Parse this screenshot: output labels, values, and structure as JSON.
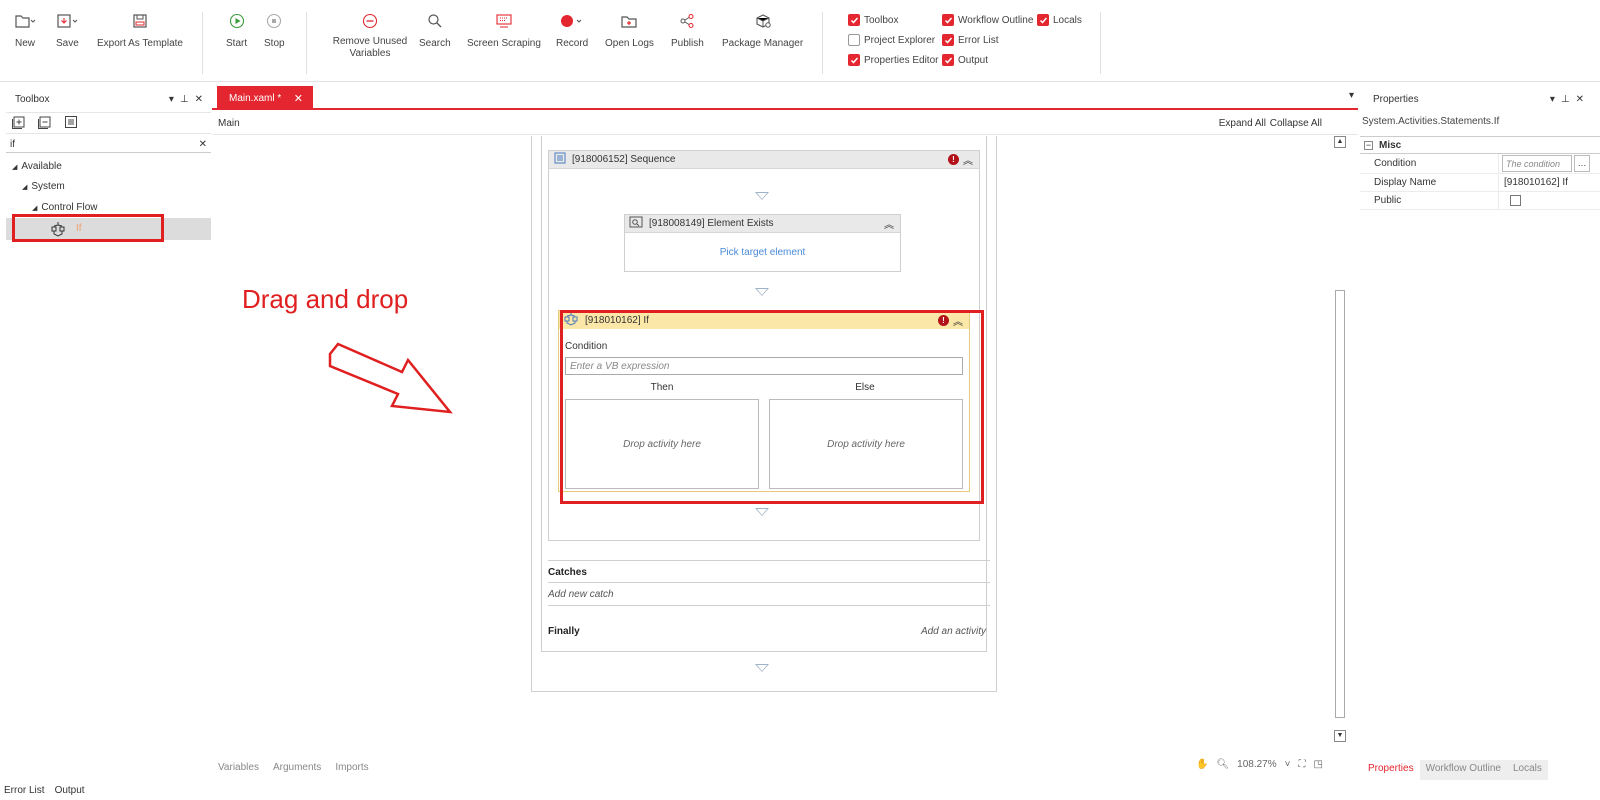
{
  "ribbon": {
    "buttons": [
      {
        "label": "New",
        "icon": "new-file-icon"
      },
      {
        "label": "Save",
        "icon": "save-icon"
      },
      {
        "label": "Export As Template",
        "icon": "export-template-icon"
      },
      {
        "label": "Start",
        "icon": "play-icon"
      },
      {
        "label": "Stop",
        "icon": "stop-icon"
      },
      {
        "label": "Remove Unused\nVariables",
        "icon": "remove-icon"
      },
      {
        "label": "Search",
        "icon": "search-icon"
      },
      {
        "label": "Screen Scraping",
        "icon": "screen-scraping-icon"
      },
      {
        "label": "Record",
        "icon": "record-icon"
      },
      {
        "label": "Open Logs",
        "icon": "folder-icon"
      },
      {
        "label": "Publish",
        "icon": "share-icon"
      },
      {
        "label": "Package Manager",
        "icon": "package-icon"
      }
    ],
    "panels": [
      {
        "label": "Toolbox",
        "checked": true
      },
      {
        "label": "Project Explorer",
        "checked": false
      },
      {
        "label": "Properties Editor",
        "checked": true
      },
      {
        "label": "Workflow Outline",
        "checked": true
      },
      {
        "label": "Error List",
        "checked": true
      },
      {
        "label": "Output",
        "checked": true
      },
      {
        "label": "Locals",
        "checked": true
      }
    ]
  },
  "toolbox": {
    "title": "Toolbox",
    "search_value": "if",
    "tree": {
      "available": "Available",
      "system": "System",
      "control_flow": "Control Flow",
      "item": "If"
    }
  },
  "designer": {
    "tab_label": "Main.xaml *",
    "breadcrumb": "Main",
    "expand_all": "Expand All",
    "collapse_all": "Collapse All",
    "sequence_title": "[918006152] Sequence",
    "element_exists_title": "[918008149] Element Exists",
    "pick_target": "Pick target element",
    "if_title": "[918010162] If",
    "condition_label": "Condition",
    "condition_placeholder": "Enter a VB expression",
    "then_label": "Then",
    "else_label": "Else",
    "drop_then": "Drop activity here",
    "drop_else": "Drop activity here",
    "catches_label": "Catches",
    "add_catch": "Add new catch",
    "finally_label": "Finally",
    "add_activity": "Add an activity",
    "bottom_tabs": [
      "Variables",
      "Arguments",
      "Imports"
    ],
    "zoom": "108.27%"
  },
  "annotation": {
    "text": "Drag and drop"
  },
  "properties": {
    "title": "Properties",
    "type_name": "System.Activities.Statements.If",
    "category": "Misc",
    "rows": [
      {
        "name": "Condition",
        "value": "The condition"
      },
      {
        "name": "Display Name",
        "value": "[918010162] If"
      },
      {
        "name": "Public",
        "value": ""
      }
    ],
    "bottom_tabs": [
      "Properties",
      "Workflow Outline",
      "Locals"
    ]
  },
  "status_tabs": [
    "Error List",
    "Output"
  ],
  "colors": {
    "accent": "#e3262f",
    "if_header": "#fbe7a7",
    "annotation": "#e02020"
  }
}
